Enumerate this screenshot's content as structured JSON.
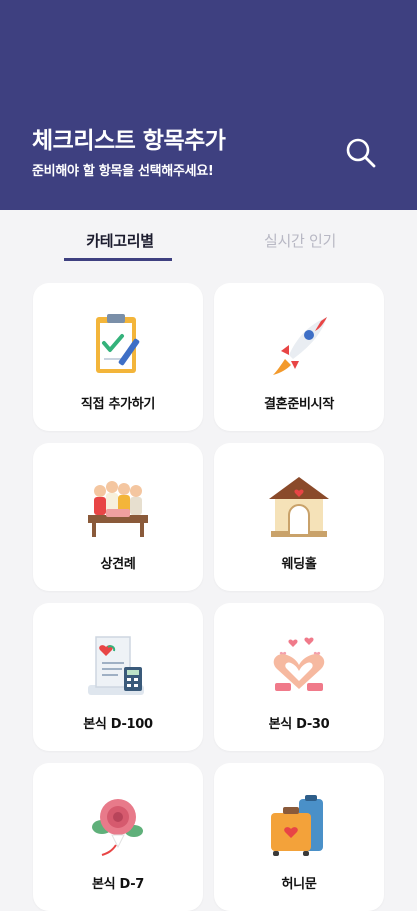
{
  "header": {
    "title": "체크리스트 항목추가",
    "subtitle": "준비해야 할 항목을 선택해주세요!",
    "search_icon": "search-icon",
    "color": "#3e4080"
  },
  "tabs": [
    {
      "label": "카테고리별",
      "active": true
    },
    {
      "label": "실시간 인기",
      "active": false
    }
  ],
  "categories": [
    {
      "label": "직접 추가하기",
      "icon": "clipboard-checklist-icon"
    },
    {
      "label": "결혼준비시작",
      "icon": "rocket-icon"
    },
    {
      "label": "상견례",
      "icon": "family-dinner-icon"
    },
    {
      "label": "웨딩홀",
      "icon": "wedding-hall-icon"
    },
    {
      "label": "본식 D-100",
      "icon": "receipt-calculator-icon"
    },
    {
      "label": "본식 D-30",
      "icon": "heart-hands-icon"
    },
    {
      "label": "본식 D-7",
      "icon": "bouquet-icon"
    },
    {
      "label": "허니문",
      "icon": "suitcase-icon"
    }
  ]
}
